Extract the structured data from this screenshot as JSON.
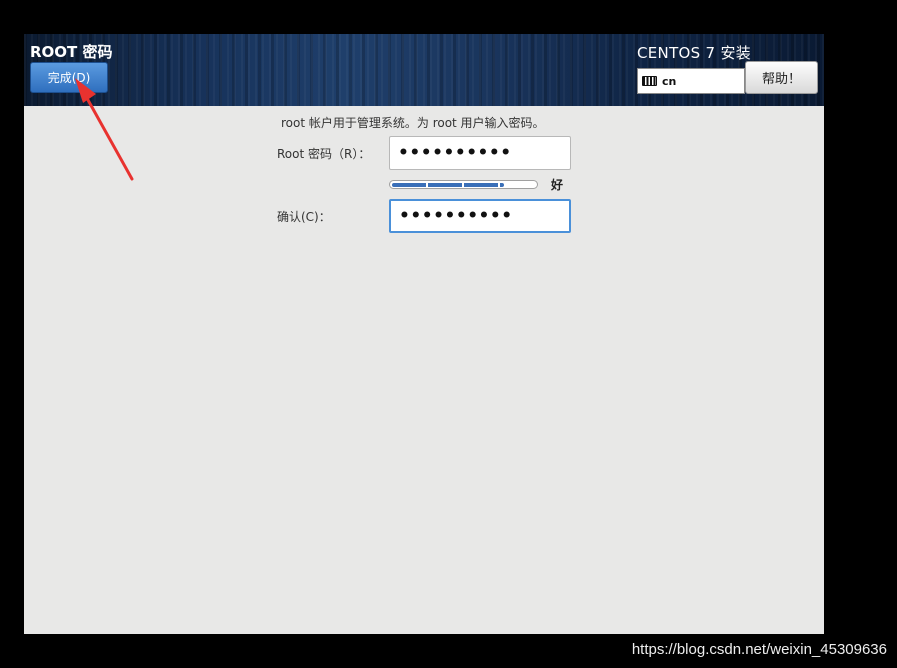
{
  "header": {
    "page_title": "ROOT 密码",
    "done_label": "完成(D)",
    "install_title": "CENTOS 7 安装",
    "keyboard_layout": "cn",
    "help_label": "帮助！"
  },
  "form": {
    "description": "root 帐户用于管理系统。为 root 用户输入密码。",
    "root_label": "Root 密码（R）：",
    "root_value": "••••••••••",
    "strength_label": "好",
    "strength_fraction": 0.78,
    "confirm_label": "确认(C)：",
    "confirm_value": "••••••••••"
  },
  "colors": {
    "accent": "#2f6fbe",
    "annotation_arrow": "#e8322f"
  },
  "watermark": "https://blog.csdn.net/weixin_45309636"
}
